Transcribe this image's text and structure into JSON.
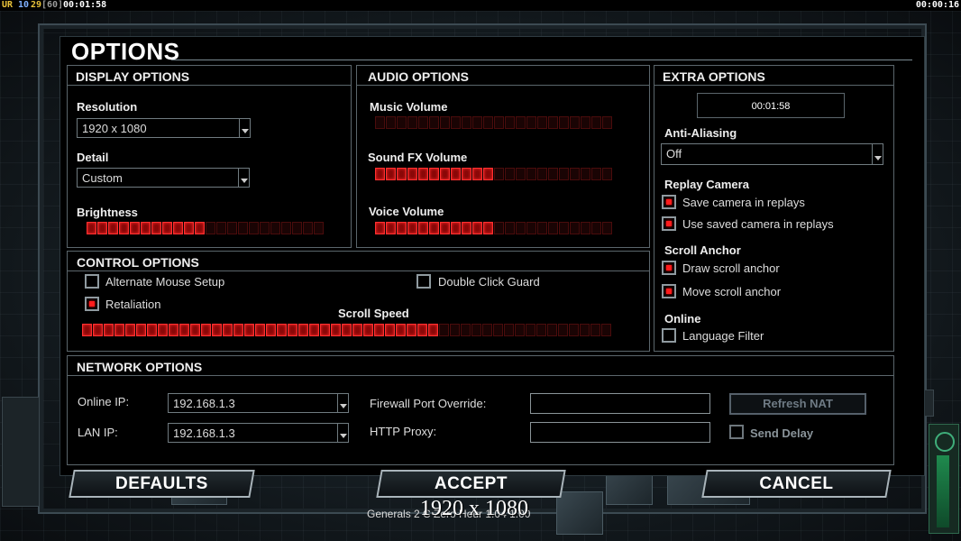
{
  "status_bar": {
    "ur": "UR",
    "n1": "10",
    "n2": "29",
    "n3": "[60]",
    "time_left": "00:01:58",
    "time_right": "00:00:16"
  },
  "dialog": {
    "title": "OPTIONS"
  },
  "display": {
    "header": "DISPLAY OPTIONS",
    "resolution_label": "Resolution",
    "resolution_value": "1920 x 1080",
    "detail_label": "Detail",
    "detail_value": "Custom",
    "brightness_label": "Brightness",
    "brightness_level": 0.5
  },
  "audio": {
    "header": "AUDIO OPTIONS",
    "music_label": "Music Volume",
    "music_level": 0,
    "sfx_label": "Sound FX Volume",
    "sfx_level": 0.5,
    "voice_label": "Voice Volume",
    "voice_level": 0.5
  },
  "extra": {
    "header": "EXTRA OPTIONS",
    "clock": "00:01:58",
    "aa_label": "Anti-Aliasing",
    "aa_value": "Off",
    "replay_label": "Replay Camera",
    "save_camera": "Save camera in replays",
    "use_camera": "Use saved camera in replays",
    "scroll_anchor_label": "Scroll Anchor",
    "draw_anchor": "Draw scroll anchor",
    "move_anchor": "Move scroll anchor",
    "online_label": "Online",
    "language_filter": "Language Filter"
  },
  "control": {
    "header": "CONTROL OPTIONS",
    "alt_mouse": "Alternate Mouse Setup",
    "double_click": "Double Click Guard",
    "retaliation": "Retaliation",
    "scroll_speed_label": "Scroll Speed",
    "scroll_speed_level": 0.68
  },
  "network": {
    "header": "NETWORK OPTIONS",
    "online_ip_label": "Online IP:",
    "online_ip": "192.168.1.3",
    "lan_ip_label": "LAN IP:",
    "lan_ip": "192.168.1.3",
    "firewall_label": "Firewall Port Override:",
    "firewall_value": "",
    "proxy_label": "HTTP Proxy:",
    "proxy_value": "",
    "refresh_nat": "Refresh NAT",
    "send_delay": "Send Delay"
  },
  "buttons": {
    "defaults": "DEFAULTS",
    "accept": "ACCEPT",
    "cancel": "CANCEL"
  },
  "footer": {
    "version": "Generals 2 C Zero Hour 1.04 1.00",
    "overlay": "1920 x 1080"
  },
  "colors": {
    "slider_on": "#ff3030",
    "check_on": "#ff1c1c",
    "panel_border": "#5b666c"
  }
}
